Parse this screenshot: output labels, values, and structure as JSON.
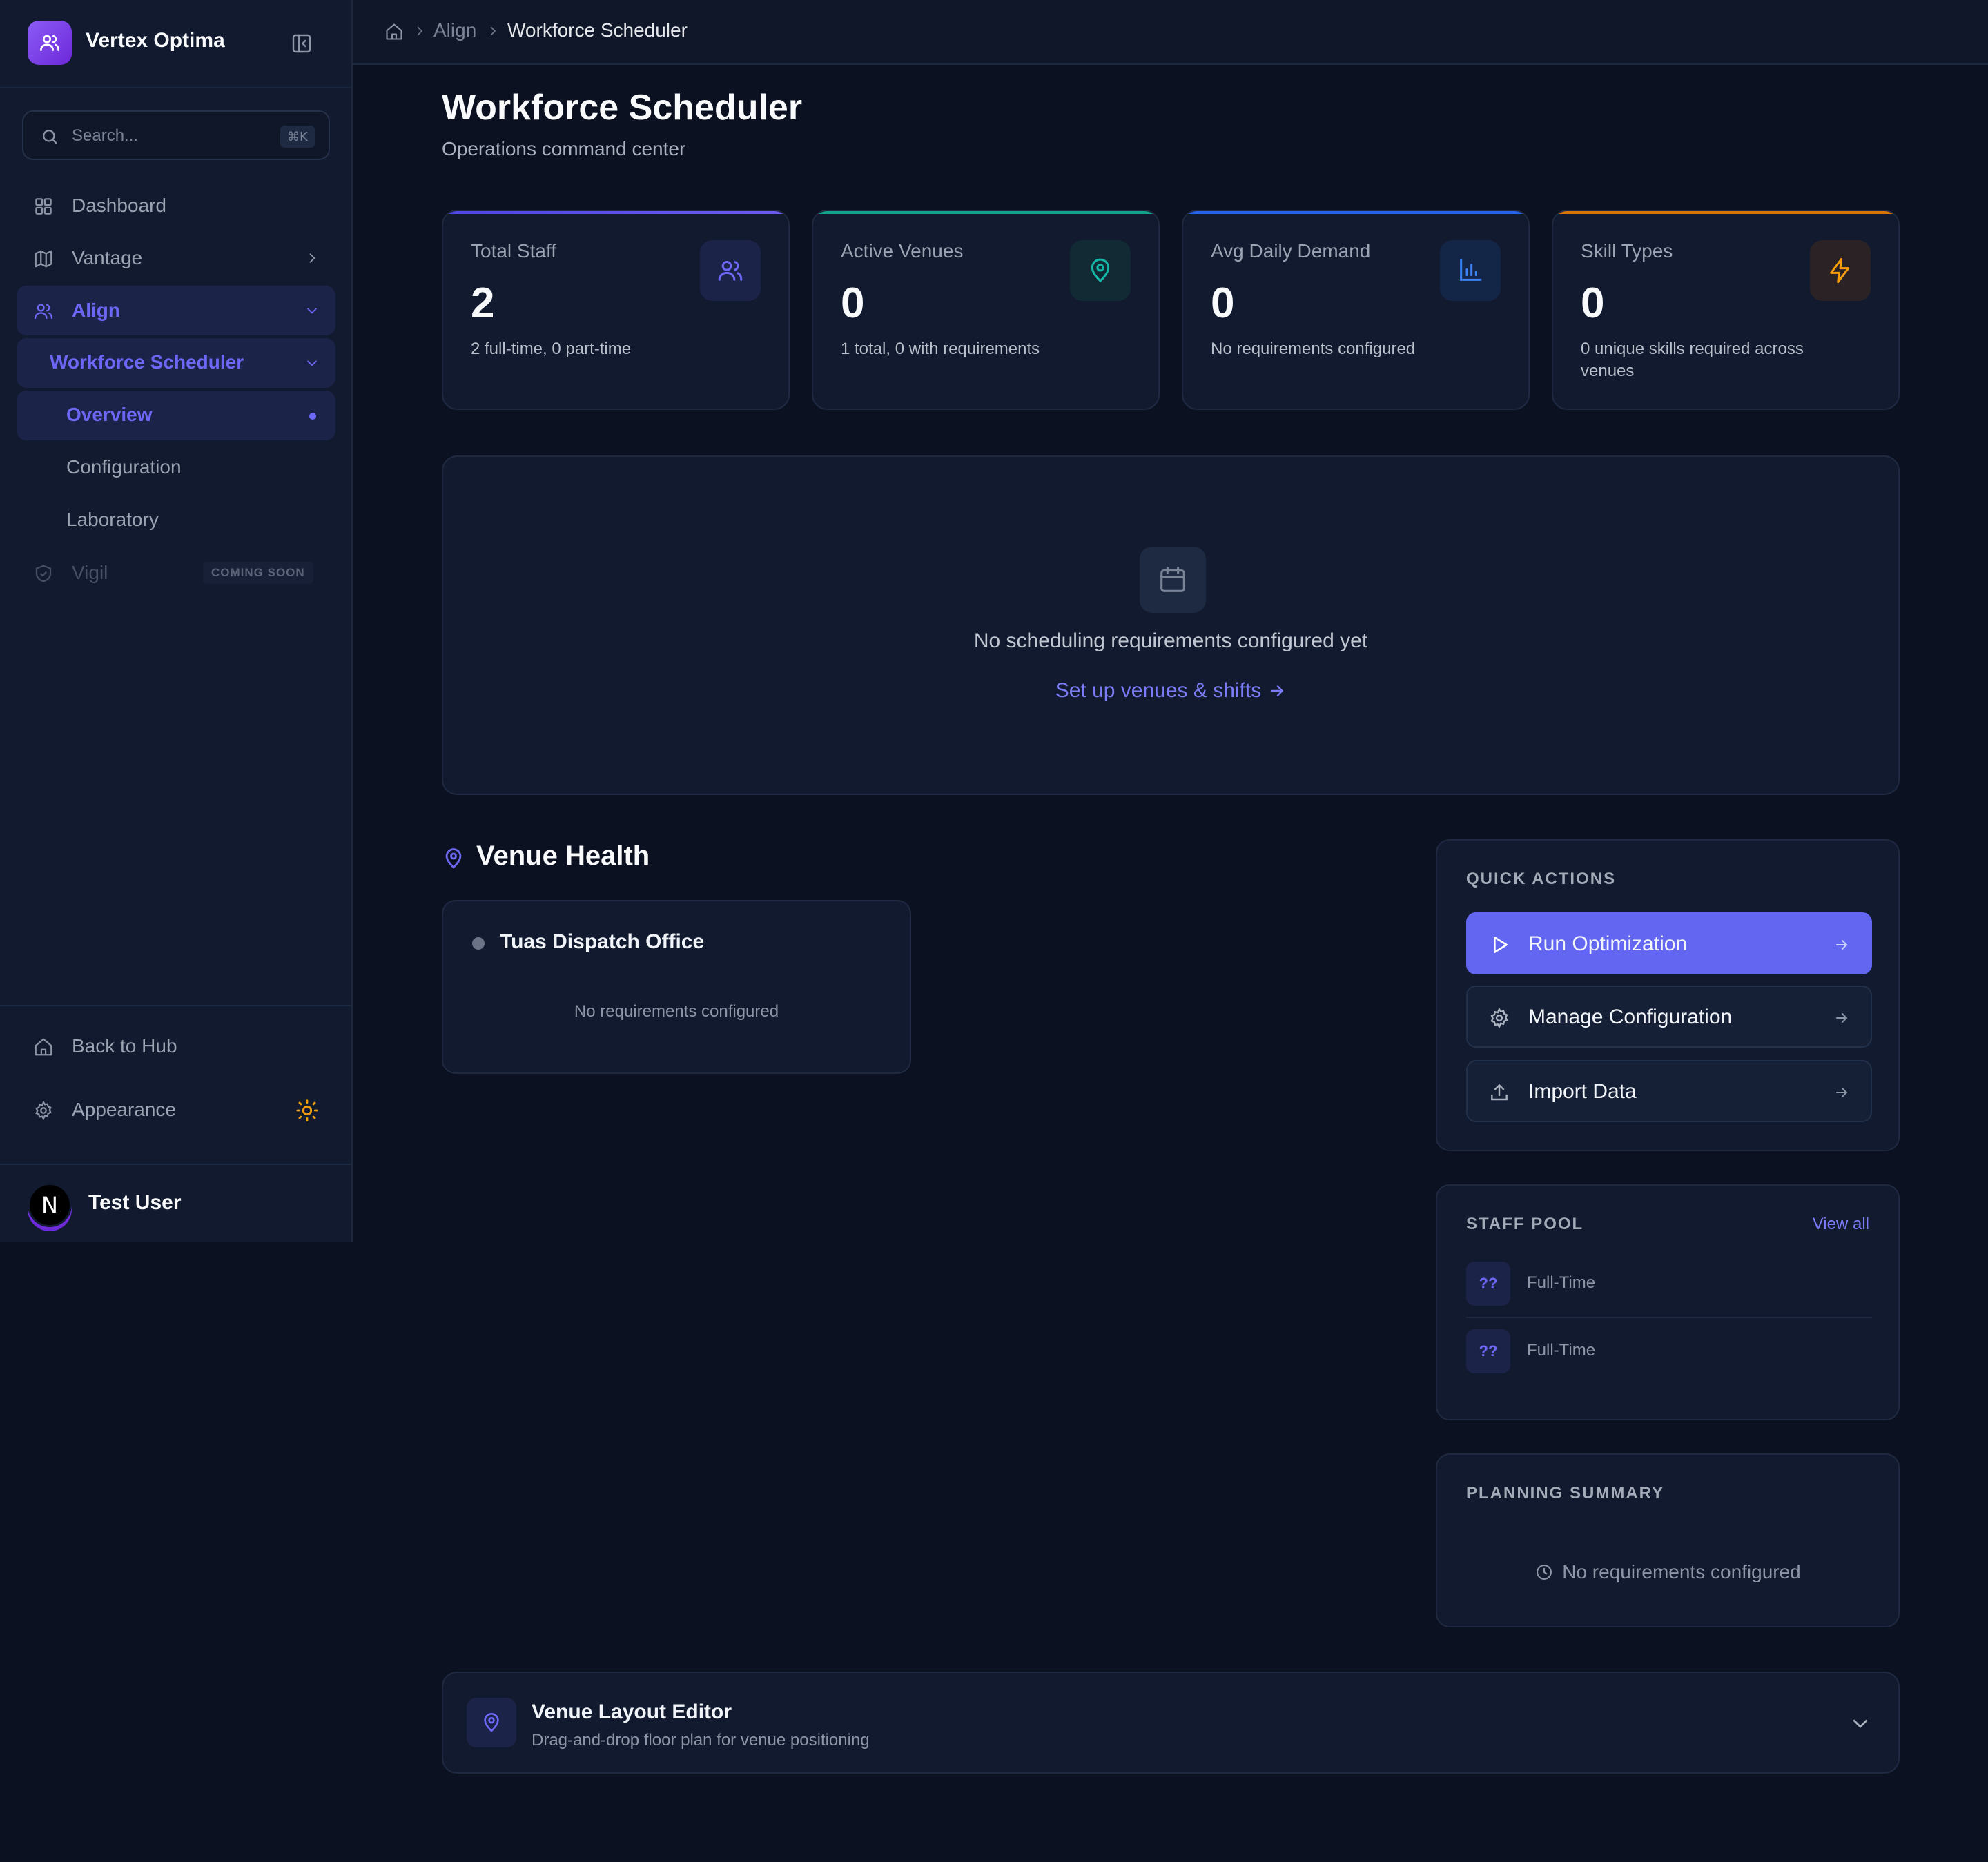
{
  "sidebar": {
    "brand": "Vertex Optima",
    "search_placeholder": "Search...",
    "search_shortcut": "⌘K",
    "nav": {
      "dashboard": "Dashboard",
      "vantage": "Vantage",
      "align": "Align",
      "workforce_scheduler": "Workforce Scheduler",
      "overview": "Overview",
      "configuration": "Configuration",
      "laboratory": "Laboratory",
      "vigil": "Vigil",
      "vigil_badge": "COMING SOON"
    },
    "footer": {
      "back_to_hub": "Back to Hub",
      "appearance": "Appearance"
    },
    "user": {
      "initial": "N",
      "name": "Test User"
    }
  },
  "breadcrumb": {
    "section": "Align",
    "current": "Workforce Scheduler"
  },
  "header": {
    "title": "Workforce Scheduler",
    "subtitle": "Operations command center"
  },
  "stats": [
    {
      "label": "Total Staff",
      "value": "2",
      "desc": "2 full-time, 0 part-time",
      "accent": "#6d5cf0",
      "icon": "users-icon"
    },
    {
      "label": "Active Venues",
      "value": "0",
      "desc": "1 total, 0 with requirements",
      "accent": "#14a38b",
      "icon": "map-pin-icon"
    },
    {
      "label": "Avg Daily Demand",
      "value": "0",
      "desc": "No requirements configured",
      "accent": "#2563eb",
      "icon": "bar-chart-icon"
    },
    {
      "label": "Skill Types",
      "value": "0",
      "desc": "0 unique skills required across venues",
      "accent": "#d97706",
      "icon": "zap-icon"
    }
  ],
  "empty_state": {
    "message": "No scheduling requirements configured yet",
    "link": "Set up venues & shifts"
  },
  "venue_health": {
    "title": "Venue Health",
    "venues": [
      {
        "name": "Tuas Dispatch Office",
        "status": "No requirements configured"
      }
    ]
  },
  "quick_actions": {
    "title": "QUICK ACTIONS",
    "run": "Run Optimization",
    "manage": "Manage Configuration",
    "import": "Import Data"
  },
  "staff_pool": {
    "title": "STAFF POOL",
    "view_all": "View all",
    "members": [
      {
        "initials": "??",
        "type": "Full-Time"
      },
      {
        "initials": "??",
        "type": "Full-Time"
      }
    ]
  },
  "planning_summary": {
    "title": "PLANNING SUMMARY",
    "message": "No requirements configured"
  },
  "layout_editor": {
    "title": "Venue Layout Editor",
    "subtitle": "Drag-and-drop floor plan for venue positioning"
  },
  "colors": {
    "primary": "#6366f1",
    "accent_text": "#6d67f5",
    "background": "#0b1120",
    "card": "#111a2e",
    "amber": "#f59e0b"
  }
}
